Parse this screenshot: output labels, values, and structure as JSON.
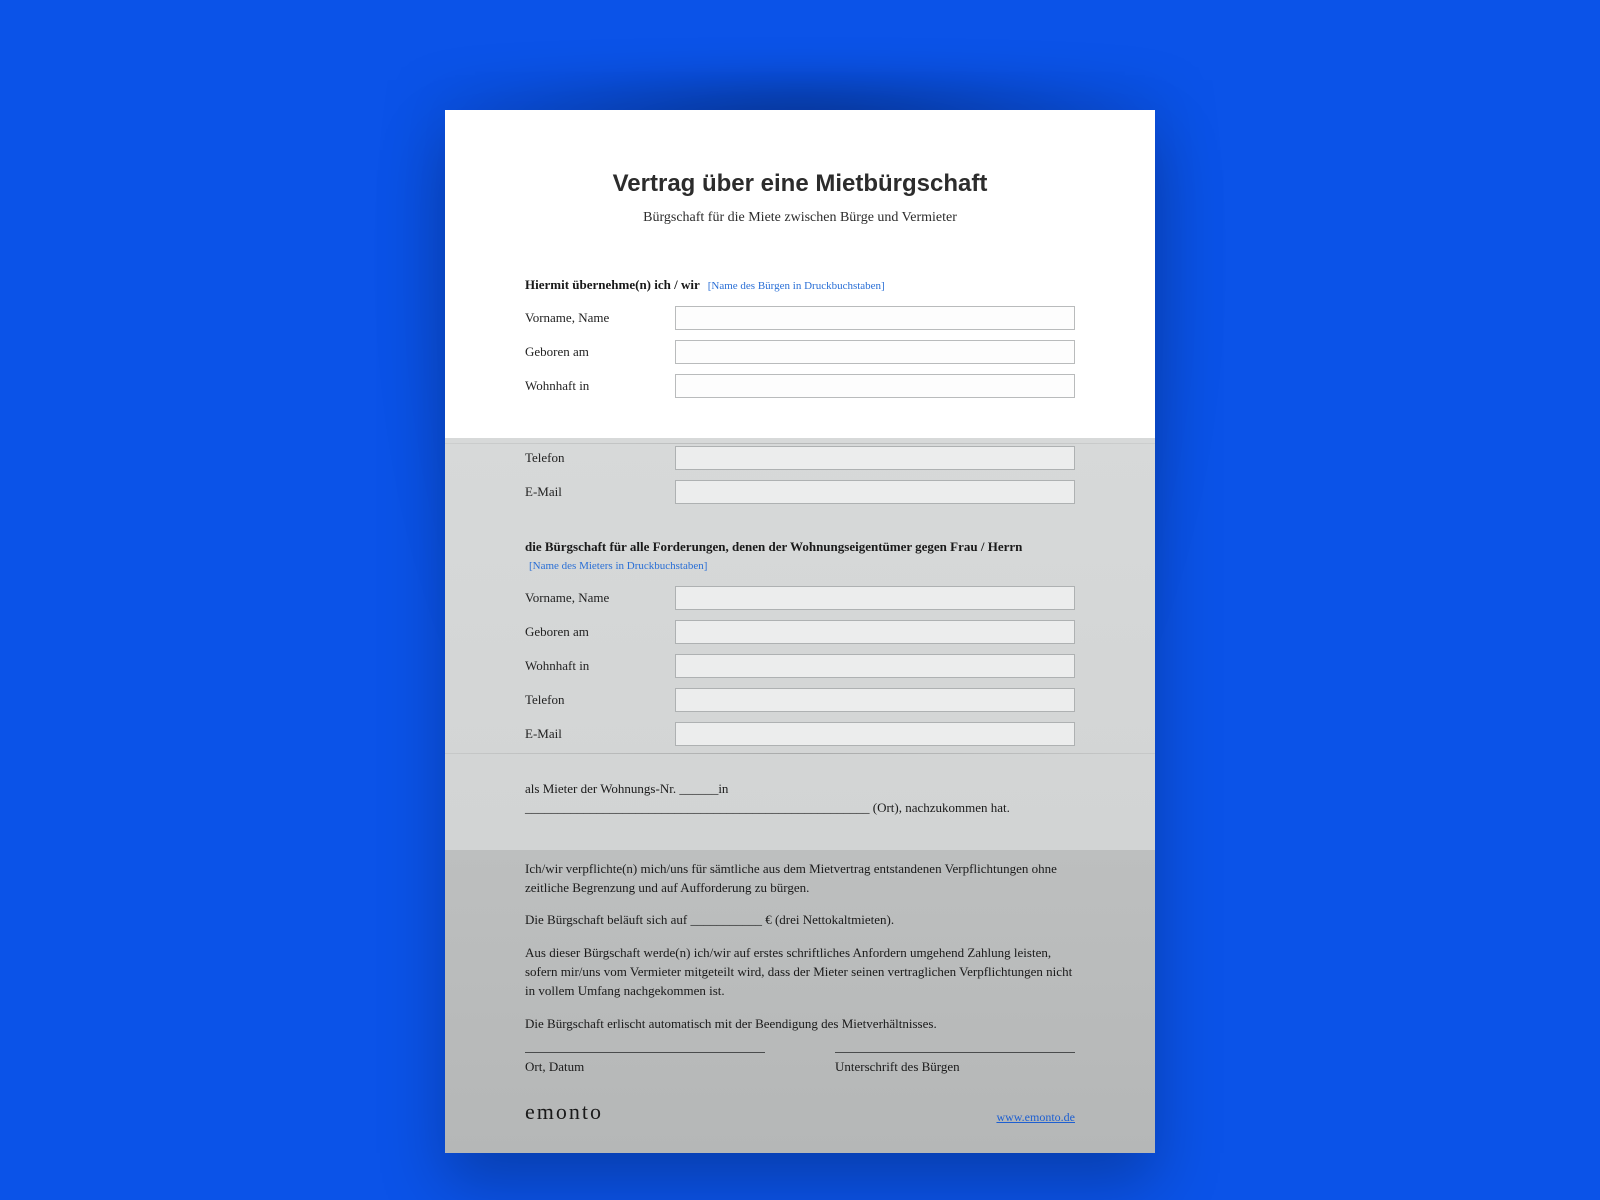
{
  "header": {
    "title": "Vertrag über eine Mietbürgschaft",
    "subtitle": "Bürgschaft für die Miete zwischen Bürge und Vermieter"
  },
  "section1": {
    "lead": "Hiermit übernehme(n) ich / wir",
    "hint": "[Name des Bürgen in Druckbuchstaben]",
    "fields": {
      "name_label": "Vorname, Name",
      "born_label": "Geboren am",
      "address_label": "Wohnhaft in",
      "phone_label": "Telefon",
      "email_label": "E-Mail"
    }
  },
  "section2": {
    "lead": "die Bürgschaft für alle Forderungen, denen der Wohnungseigentümer gegen Frau / Herrn",
    "hint": "[Name des Mieters in Druckbuchstaben]",
    "fields": {
      "name_label": "Vorname, Name",
      "born_label": "Geboren am",
      "address_label": "Wohnhaft in",
      "phone_label": "Telefon",
      "email_label": "E-Mail"
    }
  },
  "body": {
    "p1": "als Mieter der Wohnungs-Nr. ______in _____________________________________________________ (Ort), nachzukommen hat.",
    "p2": "Ich/wir verpflichte(n) mich/uns für sämtliche aus dem Mietvertrag entstandenen Verpflichtungen ohne zeitliche Begrenzung und auf Aufforderung zu bürgen.",
    "p3": "Die Bürgschaft beläuft sich auf ___________ € (drei Nettokaltmieten).",
    "p4": "Aus dieser Bürgschaft werde(n) ich/wir auf erstes schriftliches Anfordern umgehend Zahlung leisten, sofern mir/uns vom Vermieter mitgeteilt wird, dass der Mieter seinen vertraglichen Verpflichtungen nicht in vollem Umfang nachgekommen ist.",
    "p5": "Die Bürgschaft erlischt automatisch mit der Beendigung des Mietverhältnisses."
  },
  "signature": {
    "left": "Ort, Datum",
    "right": "Unterschrift des Bürgen"
  },
  "footer": {
    "brand": "emonto",
    "link": "www.emonto.de"
  }
}
